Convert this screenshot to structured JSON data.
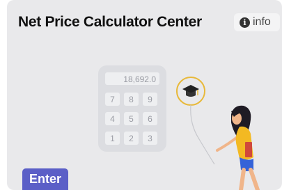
{
  "card": {
    "title": "Net Price Calculator Center",
    "info_label": "info",
    "enter_label": "Enter"
  },
  "calculator": {
    "display": "18,692.0",
    "keys": [
      "7",
      "8",
      "9",
      "4",
      "5",
      "6",
      "1",
      "2",
      "3"
    ]
  },
  "colors": {
    "card_bg": "#e9e9eb",
    "accent": "#5b5fc7",
    "balloon_outline": "#e8b93a"
  },
  "icons": {
    "info": "info-circle-icon",
    "balloon": "graduation-cap-icon"
  }
}
